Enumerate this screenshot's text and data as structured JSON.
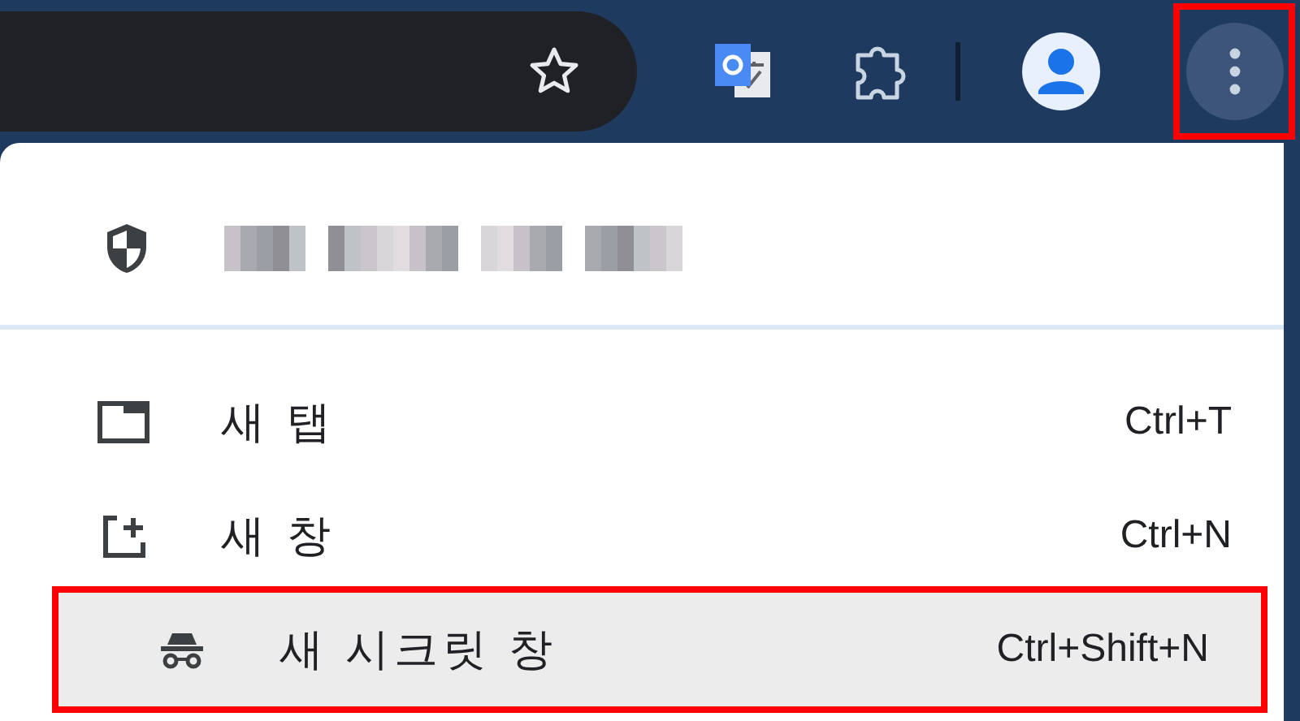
{
  "toolbar": {
    "menu_button": {
      "annotated": true
    }
  },
  "site_info": {
    "redacted": true
  },
  "menu_items": [
    {
      "kind": "new-tab",
      "label": "새 탭",
      "shortcut": "Ctrl+T",
      "selected": false,
      "annotated": false
    },
    {
      "kind": "new-window",
      "label": "새 창",
      "shortcut": "Ctrl+N",
      "selected": false,
      "annotated": false
    },
    {
      "kind": "incognito",
      "label": "새 시크릿 창",
      "shortcut": "Ctrl+Shift+N",
      "selected": true,
      "annotated": true
    }
  ]
}
